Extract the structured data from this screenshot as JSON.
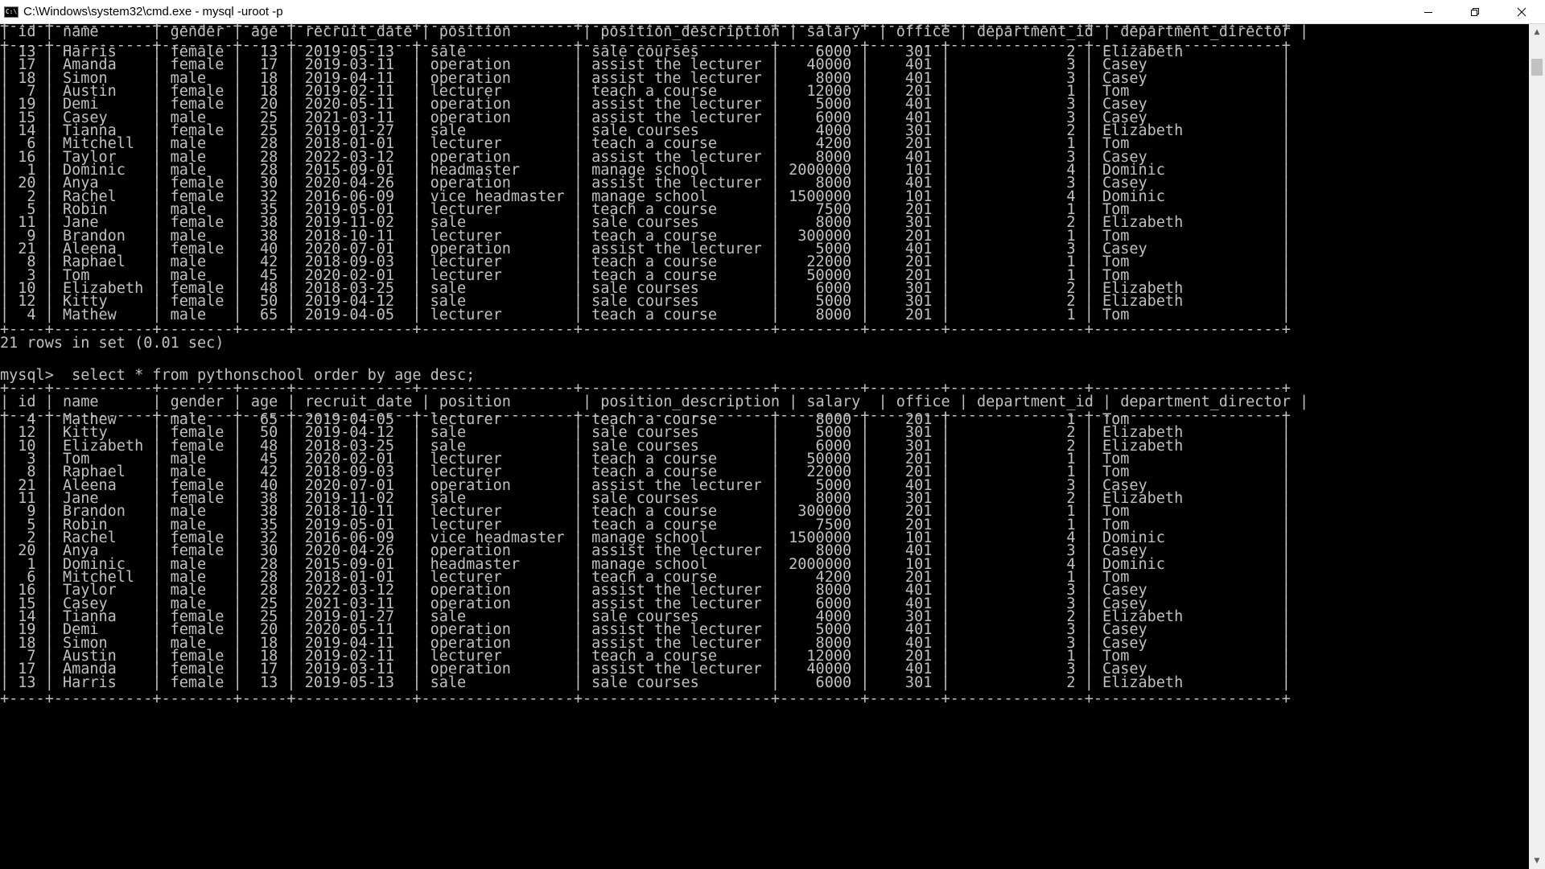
{
  "window": {
    "title": "C:\\Windows\\system32\\cmd.exe - mysql  -uroot -p",
    "icon": "cmd-icon",
    "icon_text": "C:\\"
  },
  "table_border": "+----+-----------+--------+-----+-------------+-----------------+---------------------+---------+--------+---------------+---------------------+",
  "columns": [
    "id",
    "name",
    "gender",
    "age",
    "recruit_date",
    "position",
    "position_description",
    "salary",
    "office",
    "department_id",
    "department_director"
  ],
  "first_result": {
    "rows": [
      [
        "13",
        "Harris",
        "female",
        "13",
        "2019-05-13",
        "sale",
        "sale courses",
        "6000",
        "301",
        "2",
        "Elizabeth"
      ],
      [
        "17",
        "Amanda",
        "female",
        "17",
        "2019-03-11",
        "operation",
        "assist the lecturer",
        "40000",
        "401",
        "3",
        "Casey"
      ],
      [
        "18",
        "Simon",
        "male",
        "18",
        "2019-04-11",
        "operation",
        "assist the lecturer",
        "8000",
        "401",
        "3",
        "Casey"
      ],
      [
        "7",
        "Austin",
        "female",
        "18",
        "2019-02-11",
        "lecturer",
        "teach a course",
        "12000",
        "201",
        "1",
        "Tom"
      ],
      [
        "19",
        "Demi",
        "female",
        "20",
        "2020-05-11",
        "operation",
        "assist the lecturer",
        "5000",
        "401",
        "3",
        "Casey"
      ],
      [
        "15",
        "Casey",
        "male",
        "25",
        "2021-03-11",
        "operation",
        "assist the lecturer",
        "6000",
        "401",
        "3",
        "Casey"
      ],
      [
        "14",
        "Tianna",
        "female",
        "25",
        "2019-01-27",
        "sale",
        "sale courses",
        "4000",
        "301",
        "2",
        "Elizabeth"
      ],
      [
        "6",
        "Mitchell",
        "male",
        "28",
        "2018-01-01",
        "lecturer",
        "teach a course",
        "4200",
        "201",
        "1",
        "Tom"
      ],
      [
        "16",
        "Taylor",
        "male",
        "28",
        "2022-03-12",
        "operation",
        "assist the lecturer",
        "8000",
        "401",
        "3",
        "Casey"
      ],
      [
        "1",
        "Dominic",
        "male",
        "28",
        "2015-09-01",
        "headmaster",
        "manage school",
        "2000000",
        "101",
        "4",
        "Dominic"
      ],
      [
        "20",
        "Anya",
        "female",
        "30",
        "2020-04-26",
        "operation",
        "assist the lecturer",
        "8000",
        "401",
        "3",
        "Casey"
      ],
      [
        "2",
        "Rachel",
        "female",
        "32",
        "2016-06-09",
        "vice headmaster",
        "manage school",
        "1500000",
        "101",
        "4",
        "Dominic"
      ],
      [
        "5",
        "Robin",
        "male",
        "35",
        "2019-05-01",
        "lecturer",
        "teach a course",
        "7500",
        "201",
        "1",
        "Tom"
      ],
      [
        "11",
        "Jane",
        "female",
        "38",
        "2019-11-02",
        "sale",
        "sale courses",
        "8000",
        "301",
        "2",
        "Elizabeth"
      ],
      [
        "9",
        "Brandon",
        "male",
        "38",
        "2018-10-11",
        "lecturer",
        "teach a course",
        "300000",
        "201",
        "1",
        "Tom"
      ],
      [
        "21",
        "Aleena",
        "female",
        "40",
        "2020-07-01",
        "operation",
        "assist the lecturer",
        "5000",
        "401",
        "3",
        "Casey"
      ],
      [
        "8",
        "Raphael",
        "male",
        "42",
        "2018-09-03",
        "lecturer",
        "teach a course",
        "22000",
        "201",
        "1",
        "Tom"
      ],
      [
        "3",
        "Tom",
        "male",
        "45",
        "2020-02-01",
        "lecturer",
        "teach a course",
        "50000",
        "201",
        "1",
        "Tom"
      ],
      [
        "10",
        "Elizabeth",
        "female",
        "48",
        "2018-03-25",
        "sale",
        "sale courses",
        "6000",
        "301",
        "2",
        "Elizabeth"
      ],
      [
        "12",
        "Kitty",
        "female",
        "50",
        "2019-04-12",
        "sale",
        "sale courses",
        "5000",
        "301",
        "2",
        "Elizabeth"
      ],
      [
        "4",
        "Mathew",
        "male",
        "65",
        "2019-04-05",
        "lecturer",
        "teach a course",
        "8000",
        "201",
        "1",
        "Tom"
      ]
    ]
  },
  "rows_in_set": "21 rows in set (0.01 sec)",
  "prompt": "mysql>  select * from pythonschool order by age desc;",
  "second_result": {
    "rows": [
      [
        "4",
        "Mathew",
        "male",
        "65",
        "2019-04-05",
        "lecturer",
        "teach a course",
        "8000",
        "201",
        "1",
        "Tom"
      ],
      [
        "12",
        "Kitty",
        "female",
        "50",
        "2019-04-12",
        "sale",
        "sale courses",
        "5000",
        "301",
        "2",
        "Elizabeth"
      ],
      [
        "10",
        "Elizabeth",
        "female",
        "48",
        "2018-03-25",
        "sale",
        "sale courses",
        "6000",
        "301",
        "2",
        "Elizabeth"
      ],
      [
        "3",
        "Tom",
        "male",
        "45",
        "2020-02-01",
        "lecturer",
        "teach a course",
        "50000",
        "201",
        "1",
        "Tom"
      ],
      [
        "8",
        "Raphael",
        "male",
        "42",
        "2018-09-03",
        "lecturer",
        "teach a course",
        "22000",
        "201",
        "1",
        "Tom"
      ],
      [
        "21",
        "Aleena",
        "female",
        "40",
        "2020-07-01",
        "operation",
        "assist the lecturer",
        "5000",
        "401",
        "3",
        "Casey"
      ],
      [
        "11",
        "Jane",
        "female",
        "38",
        "2019-11-02",
        "sale",
        "sale courses",
        "8000",
        "301",
        "2",
        "Elizabeth"
      ],
      [
        "9",
        "Brandon",
        "male",
        "38",
        "2018-10-11",
        "lecturer",
        "teach a course",
        "300000",
        "201",
        "1",
        "Tom"
      ],
      [
        "5",
        "Robin",
        "male",
        "35",
        "2019-05-01",
        "lecturer",
        "teach a course",
        "7500",
        "201",
        "1",
        "Tom"
      ],
      [
        "2",
        "Rachel",
        "female",
        "32",
        "2016-06-09",
        "vice headmaster",
        "manage school",
        "1500000",
        "101",
        "4",
        "Dominic"
      ],
      [
        "20",
        "Anya",
        "female",
        "30",
        "2020-04-26",
        "operation",
        "assist the lecturer",
        "8000",
        "401",
        "3",
        "Casey"
      ],
      [
        "1",
        "Dominic",
        "male",
        "28",
        "2015-09-01",
        "headmaster",
        "manage school",
        "2000000",
        "101",
        "4",
        "Dominic"
      ],
      [
        "6",
        "Mitchell",
        "male",
        "28",
        "2018-01-01",
        "lecturer",
        "teach a course",
        "4200",
        "201",
        "1",
        "Tom"
      ],
      [
        "16",
        "Taylor",
        "male",
        "28",
        "2022-03-12",
        "operation",
        "assist the lecturer",
        "8000",
        "401",
        "3",
        "Casey"
      ],
      [
        "15",
        "Casey",
        "male",
        "25",
        "2021-03-11",
        "operation",
        "assist the lecturer",
        "6000",
        "401",
        "3",
        "Casey"
      ],
      [
        "14",
        "Tianna",
        "female",
        "25",
        "2019-01-27",
        "sale",
        "sale courses",
        "4000",
        "301",
        "2",
        "Elizabeth"
      ],
      [
        "19",
        "Demi",
        "female",
        "20",
        "2020-05-11",
        "operation",
        "assist the lecturer",
        "5000",
        "401",
        "3",
        "Casey"
      ],
      [
        "18",
        "Simon",
        "male",
        "18",
        "2019-04-11",
        "operation",
        "assist the lecturer",
        "8000",
        "401",
        "3",
        "Casey"
      ],
      [
        "7",
        "Austin",
        "female",
        "18",
        "2019-02-11",
        "lecturer",
        "teach a course",
        "12000",
        "201",
        "1",
        "Tom"
      ],
      [
        "17",
        "Amanda",
        "female",
        "17",
        "2019-03-11",
        "operation",
        "assist the lecturer",
        "40000",
        "401",
        "3",
        "Casey"
      ],
      [
        "13",
        "Harris",
        "female",
        "13",
        "2019-05-13",
        "sale",
        "sale courses",
        "6000",
        "301",
        "2",
        "Elizabeth"
      ]
    ]
  },
  "colors": {
    "console_background": "#000000",
    "console_text": "#c0c0c0",
    "titlebar_background": "#ffffff",
    "scrollbar_track": "#f0f0f0",
    "scrollbar_thumb": "#c1c1c1"
  }
}
